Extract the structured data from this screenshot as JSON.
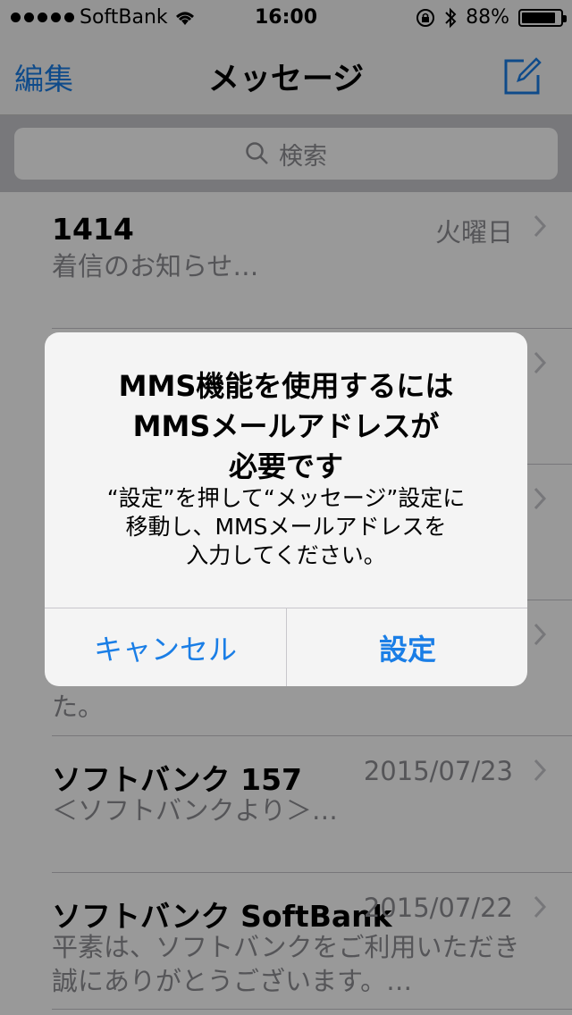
{
  "status": {
    "carrier": "SoftBank",
    "time": "16:00",
    "battery": "88%",
    "battery_level": 0.88
  },
  "nav": {
    "edit": "編集",
    "title": "メッセージ"
  },
  "search": {
    "placeholder": "検索"
  },
  "messages": [
    {
      "name": "1414",
      "date": "火曜日",
      "preview": "着信のお知らせ…"
    },
    {
      "name": "",
      "date": "",
      "preview": ""
    },
    {
      "name": "",
      "date": "",
      "preview": ""
    },
    {
      "name": "",
      "date": "",
      "preview": "た。"
    },
    {
      "name": "ソフトバンク 157",
      "date": "2015/07/23",
      "preview": "＜ソフトバンクより＞…"
    },
    {
      "name": "ソフトバンク SoftBank",
      "date": "2015/07/22",
      "preview_line1": "平素は、ソフトバンクをご利用いただき",
      "preview_line2": "誠にありがとうございます。…"
    }
  ],
  "alert": {
    "title_line1": "MMS機能を使用するには",
    "title_line2": "MMSメールアドレスが",
    "title_line3": "必要です",
    "message_line1": "“設定”を押して“メッセージ”設定に",
    "message_line2": "移動し、MMSメールアドレスを",
    "message_line3": "入力してください。",
    "cancel": "キャンセル",
    "settings": "設定"
  },
  "colors": {
    "accent": "#1a7ee6",
    "overlay": "rgba(0,0,0,0.40)"
  }
}
